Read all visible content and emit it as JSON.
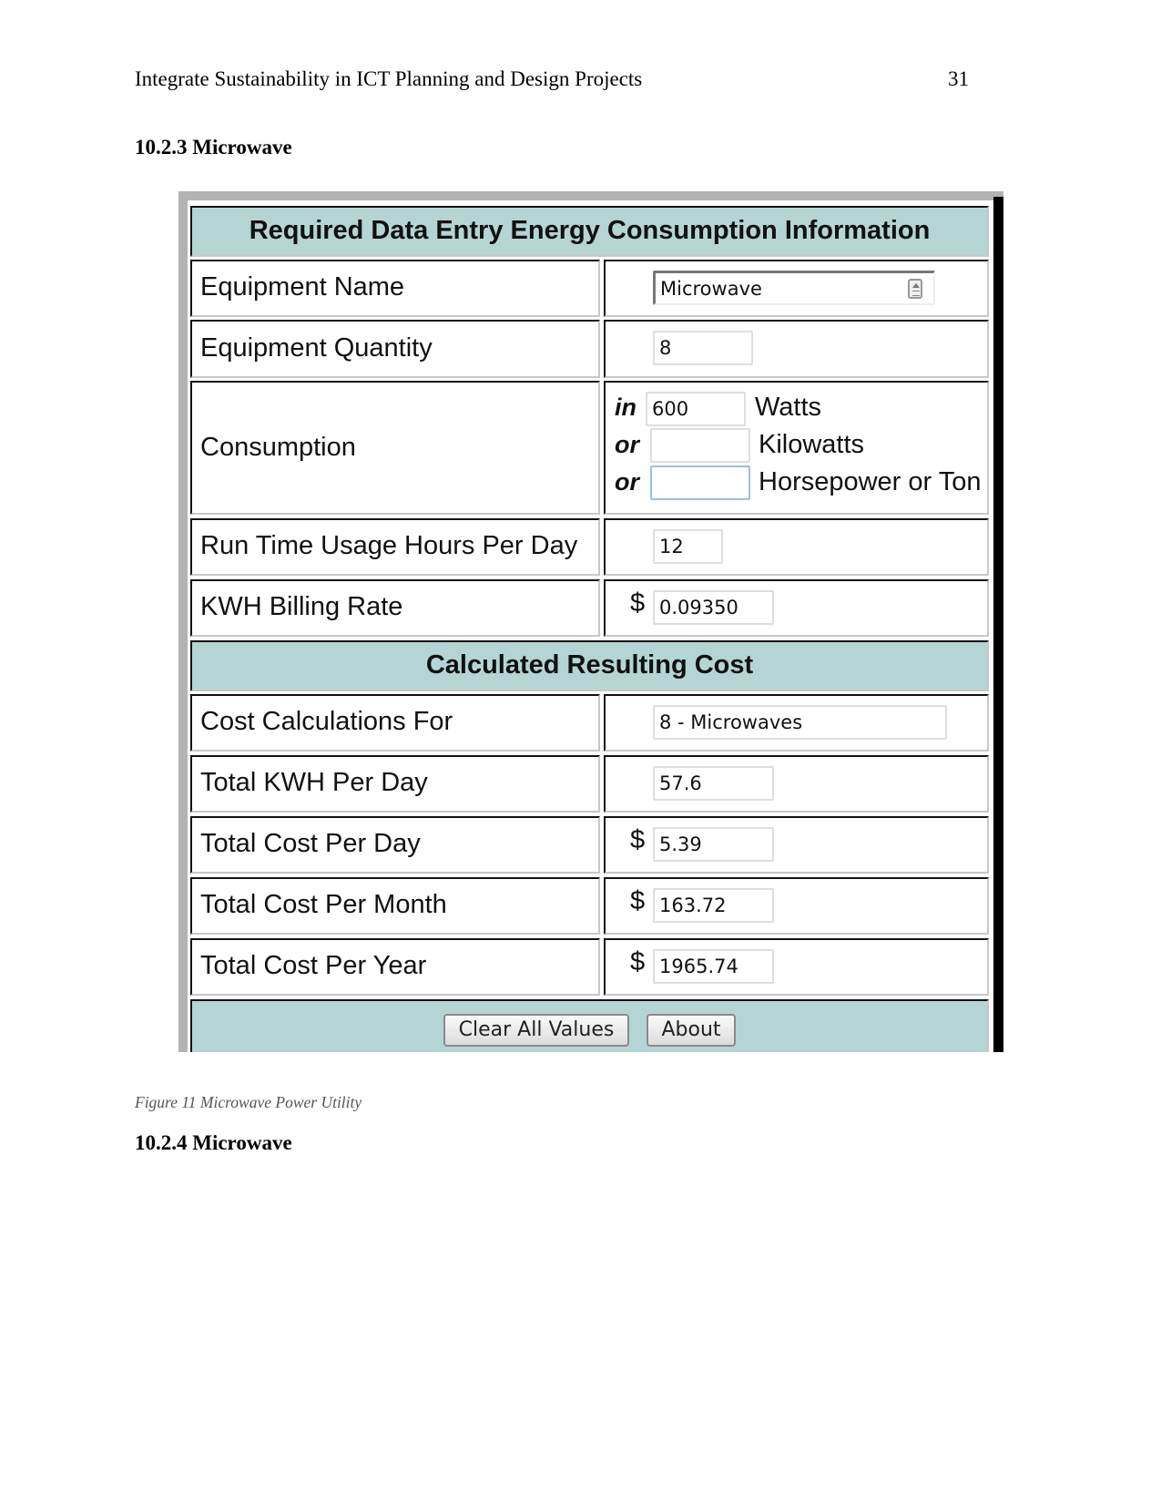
{
  "page": {
    "running_head": "Integrate Sustainability in ICT Planning and Design Projects",
    "page_number": "31",
    "section_title": "10.2.3  Microwave",
    "caption": "Figure 11 Microwave Power Utility",
    "next_section_title": "10.2.4  Microwave"
  },
  "form": {
    "required_header": "Required Data Entry Energy Consumption Information",
    "equipment_name": {
      "label": "Equipment Name",
      "value": "Microwave",
      "icon": "spinner-icon"
    },
    "equipment_quantity": {
      "label": "Equipment Quantity",
      "value": "8"
    },
    "consumption": {
      "label": "Consumption",
      "options": [
        {
          "prefix": "in",
          "value": "600",
          "unit": "Watts"
        },
        {
          "prefix": "or",
          "value": "",
          "unit": "Kilowatts"
        },
        {
          "prefix": "or",
          "value": "",
          "unit": "Horsepower or Ton"
        }
      ]
    },
    "run_time": {
      "label": "Run Time Usage Hours Per Day",
      "value": "12"
    },
    "billing_rate": {
      "label": "KWH Billing Rate",
      "currency": "$",
      "value": "0.09350"
    },
    "calculated_header": "Calculated Resulting Cost",
    "cost_for": {
      "label": "Cost Calculations For",
      "value": "8 - Microwaves"
    },
    "kwh_per_day": {
      "label": "Total KWH Per Day",
      "value": "57.6"
    },
    "cost_per_day": {
      "label": "Total Cost Per Day",
      "currency": "$",
      "value": "5.39"
    },
    "cost_per_month": {
      "label": "Total Cost Per Month",
      "currency": "$",
      "value": "163.72"
    },
    "cost_per_year": {
      "label": "Total Cost Per Year",
      "currency": "$",
      "value": "1965.74"
    },
    "buttons": {
      "clear": "Clear All Values",
      "about": "About"
    },
    "colors": {
      "band": "#b5d5d4",
      "frame": "#b3b3b3"
    }
  }
}
